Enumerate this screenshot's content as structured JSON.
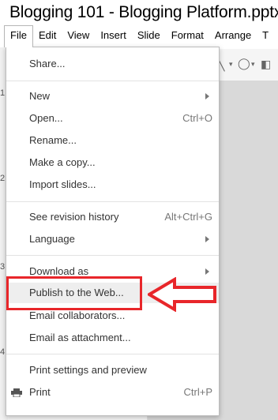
{
  "document": {
    "title": "Blogging 101 - Blogging Platform.pptx"
  },
  "menubar": {
    "items": [
      "File",
      "Edit",
      "View",
      "Insert",
      "Slide",
      "Format",
      "Arrange",
      "T"
    ]
  },
  "ruler": {
    "numbers": [
      "1",
      "2",
      "3",
      "4"
    ]
  },
  "file_menu": {
    "share": "Share...",
    "new": "New",
    "open": "Open...",
    "open_shortcut": "Ctrl+O",
    "rename": "Rename...",
    "make_copy": "Make a copy...",
    "import_slides": "Import slides...",
    "revision_history": "See revision history",
    "revision_history_shortcut": "Alt+Ctrl+G",
    "language": "Language",
    "download_as": "Download as",
    "publish": "Publish to the Web...",
    "email_collaborators": "Email collaborators...",
    "email_attachment": "Email as attachment...",
    "print_settings": "Print settings and preview",
    "print": "Print",
    "print_shortcut": "Ctrl+P"
  },
  "annotation": {
    "color": "#e8262a",
    "icon": "arrow-left-outline-icon"
  }
}
